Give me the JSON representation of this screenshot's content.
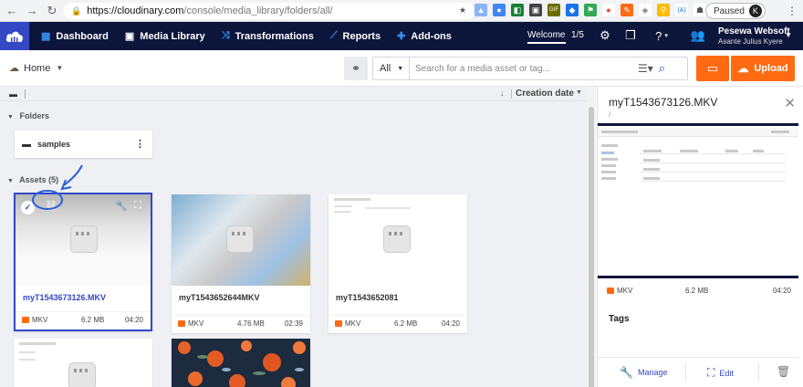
{
  "browser": {
    "url_host": "https://cloudinary.com",
    "url_path": "/console/media_library/folders/all/",
    "profile_status": "Paused",
    "profile_initial": "K",
    "extensions": [
      "★",
      "▲",
      "●",
      "◧",
      "▣",
      "GIF",
      "◆",
      "⚑",
      "●",
      "✎",
      "◈",
      "⚲",
      "(A)",
      "☗"
    ]
  },
  "header": {
    "nav": [
      {
        "label": "Dashboard",
        "icon": "dashboard-icon"
      },
      {
        "label": "Media Library",
        "icon": "media-library-icon"
      },
      {
        "label": "Transformations",
        "icon": "transformations-icon"
      },
      {
        "label": "Reports",
        "icon": "reports-icon"
      },
      {
        "label": "Add-ons",
        "icon": "puzzle-icon"
      }
    ],
    "welcome": "Welcome",
    "pager": "1/5",
    "user_name": "Pesewa Websoft",
    "user_sub": "Asante Julius Kyere"
  },
  "toolbar": {
    "home_label": "Home",
    "filter_select": "All",
    "search_placeholder": "Search for a media asset or tag...",
    "upload_label": "Upload"
  },
  "main": {
    "sort_by": "Creation date",
    "folders_title": "Folders",
    "folders": [
      {
        "name": "samples"
      }
    ],
    "assets_title": "Assets (5)",
    "assets": [
      {
        "name": "myT1543673126.MKV",
        "format": "MKV",
        "size": "6.2 MB",
        "duration": "04:20"
      },
      {
        "name": "myT1543652644MKV",
        "format": "MKV",
        "size": "4.76 MB",
        "duration": "02:39"
      },
      {
        "name": "myT1543652081",
        "format": "MKV",
        "size": "6.2 MB",
        "duration": "04:20"
      }
    ]
  },
  "panel": {
    "title": "myT1543673126.MKV",
    "subtitle": "/",
    "format": "MKV",
    "size": "6.2 MB",
    "duration": "04:20",
    "tags_label": "Tags",
    "manage_label": "Manage",
    "edit_label": "Edit"
  },
  "colors": {
    "header_bg": "#0c163b",
    "accent": "#3448c5",
    "upload": "#ff6a13"
  }
}
